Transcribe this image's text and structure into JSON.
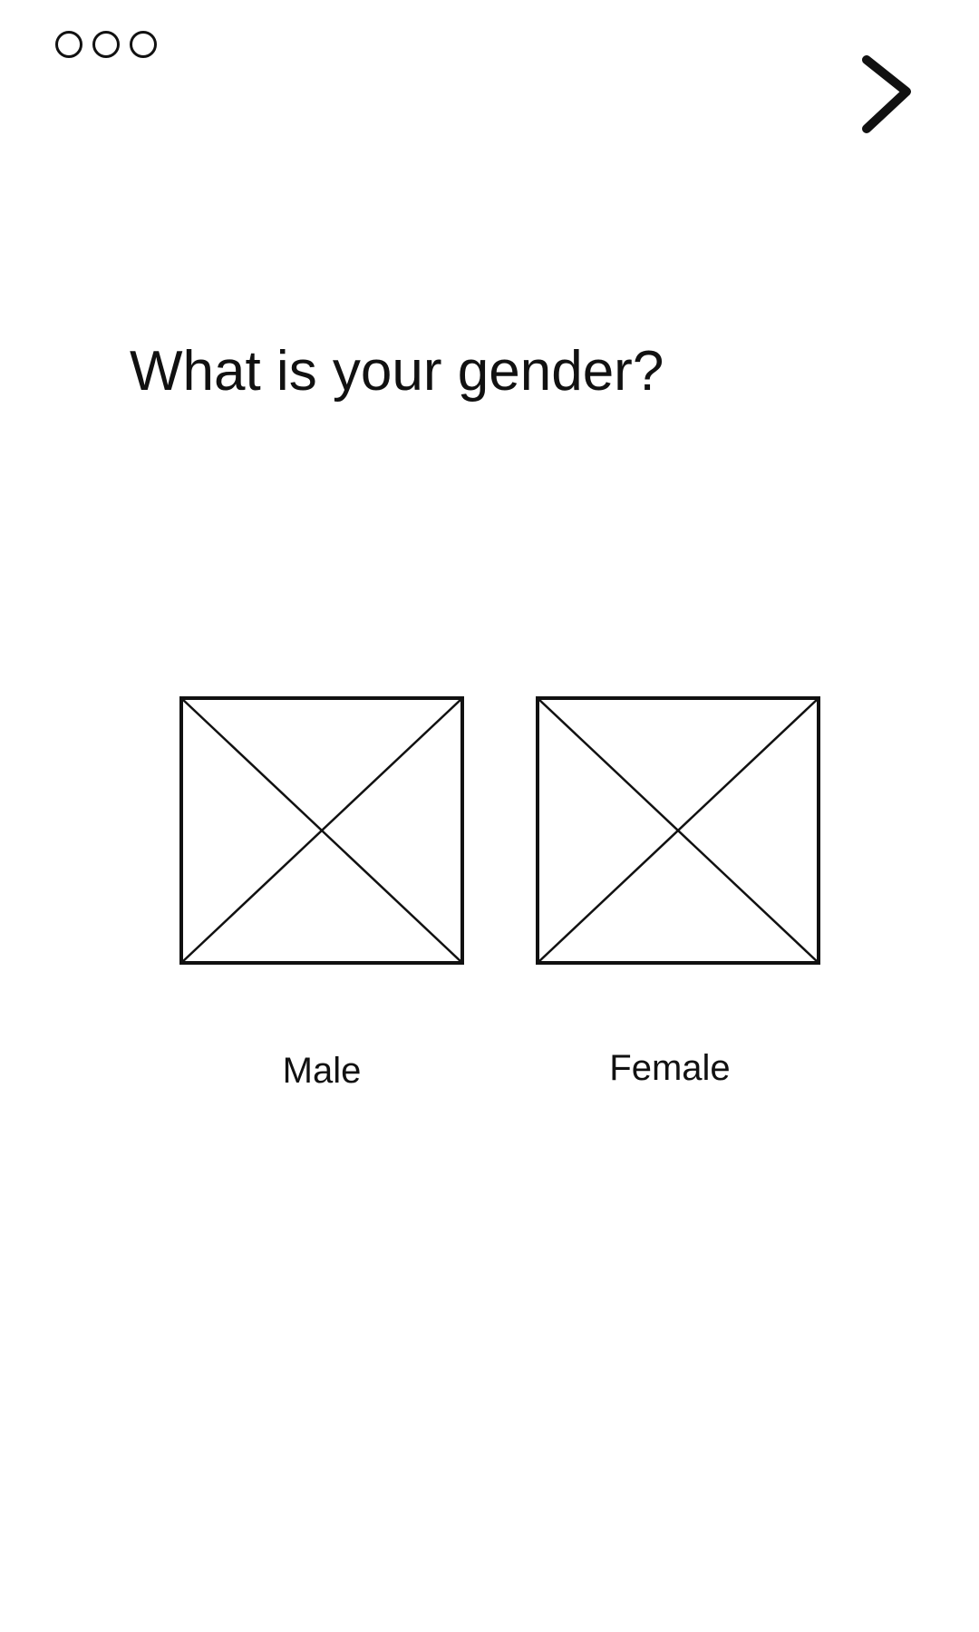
{
  "header": {
    "menu_icon": "more-dots-icon",
    "next_icon": "chevron-right-icon"
  },
  "question": {
    "title": "What is your gender?"
  },
  "options": [
    {
      "label": "Male",
      "image_icon": "image-placeholder-icon"
    },
    {
      "label": "Female",
      "image_icon": "image-placeholder-icon"
    }
  ],
  "colors": {
    "stroke": "#111111",
    "background": "#ffffff"
  }
}
